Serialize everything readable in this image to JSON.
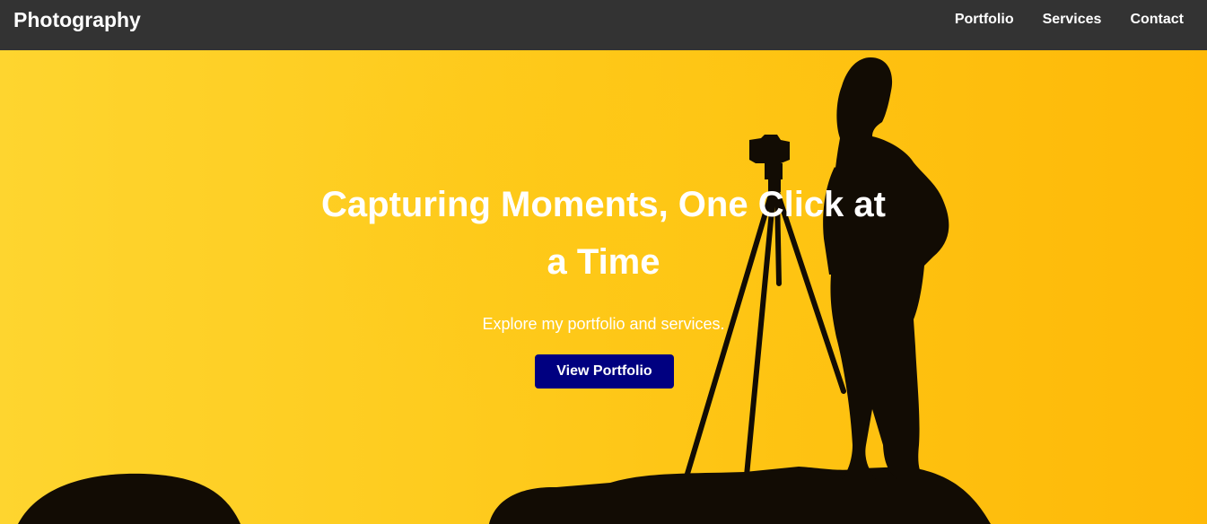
{
  "navbar": {
    "brand": "Photography",
    "links": [
      {
        "label": "Portfolio"
      },
      {
        "label": "Services"
      },
      {
        "label": "Contact"
      }
    ]
  },
  "hero": {
    "title": "Capturing Moments, One Click at a Time",
    "subtitle": "Explore my portfolio and services.",
    "cta_label": "View Portfolio"
  },
  "colors": {
    "navbar": "#333333",
    "hero_background": "#fdbf12",
    "cta": "#000080",
    "text": "#ffffff"
  }
}
